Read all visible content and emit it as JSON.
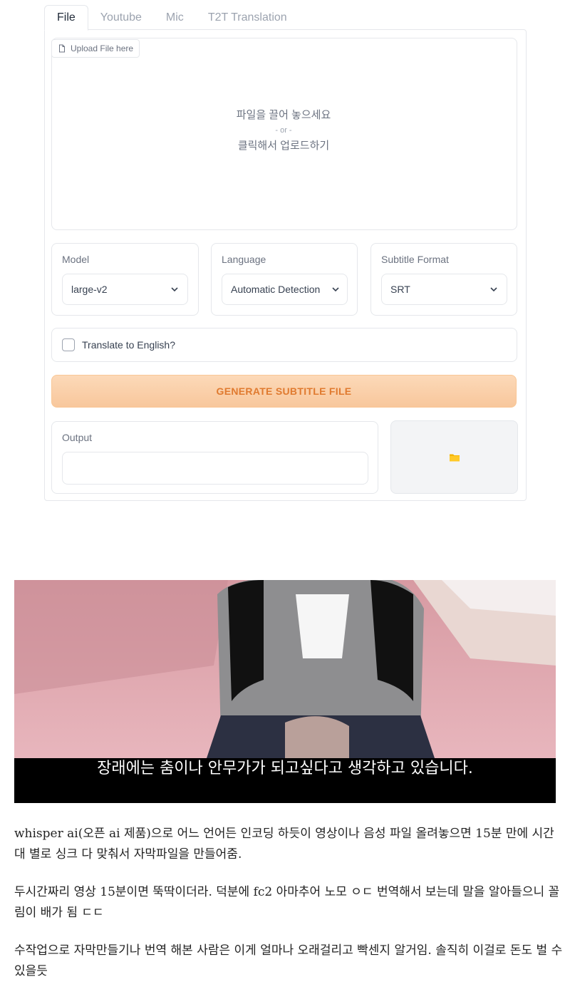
{
  "tabs": [
    {
      "label": "File",
      "active": true
    },
    {
      "label": "Youtube",
      "active": false
    },
    {
      "label": "Mic",
      "active": false
    },
    {
      "label": "T2T Translation",
      "active": false
    }
  ],
  "upload": {
    "label": "Upload File here",
    "drop_text": "파일을 끌어 놓으세요",
    "or_text": "- or -",
    "click_text": "클릭해서 업로드하기"
  },
  "model": {
    "label": "Model",
    "value": "large-v2"
  },
  "language": {
    "label": "Language",
    "value": "Automatic Detection"
  },
  "subtitle_format": {
    "label": "Subtitle Format",
    "value": "SRT"
  },
  "translate": {
    "label": "Translate to English?",
    "checked": false
  },
  "generate_button": "GENERATE SUBTITLE FILE",
  "output": {
    "label": "Output",
    "value": ""
  },
  "video": {
    "subtitle": "장래에는 춤이나 안무가가 되고싶다고 생각하고 있습니다."
  },
  "post": {
    "paragraphs": [
      "whisper ai(오픈 ai 제품)으로 어느 언어든 인코딩 하듯이 영상이나 음성 파일 올려놓으면 15분 만에 시간대 별로 싱크 다 맞춰서 자막파일을 만들어줌.",
      "두시간짜리 영상 15분이면 뚝딱이더라. 덕분에 fc2 아마추어 노모 ㅇㄷ 번역해서 보는데 말을 알아들으니 꼴림이 배가 됨 ㄷㄷ",
      "수작업으로 자막만들기나 번역 해본 사람은 이게 얼마나 오래걸리고 빡센지 알거임. 솔직히 이걸로 돈도 벌 수 있을듯"
    ]
  },
  "colors": {
    "accent_orange": "#e07a2f",
    "button_bg": "#f8c79c",
    "folder": "#f5b400",
    "border": "#e5e7eb"
  },
  "icons": {
    "upload": "file-icon",
    "dropdown": "chevron-down-icon",
    "folder": "folder-icon"
  }
}
